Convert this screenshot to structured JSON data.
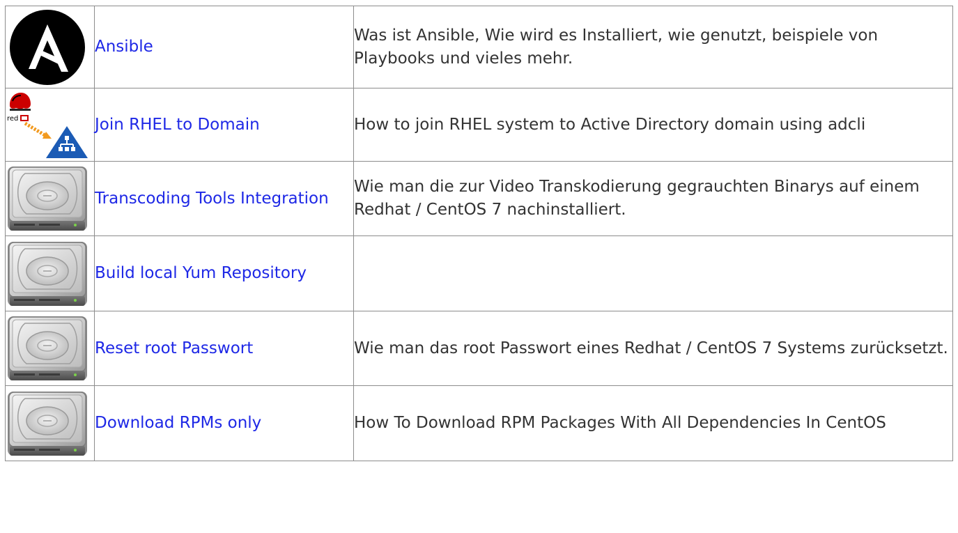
{
  "rows": [
    {
      "icon": "ansible-logo-icon",
      "link": "Ansible",
      "description": "Was ist Ansible, Wie wird es Installiert, wie genutzt, beispiele von Playbooks und vieles mehr."
    },
    {
      "icon": "redhat-join-domain-icon",
      "link": "Join RHEL to Domain",
      "description": "How to join RHEL system to Active Directory domain using adcli"
    },
    {
      "icon": "hard-drive-icon",
      "link": "Transcoding Tools Integration",
      "description": "Wie man die zur Video Transkodierung gegrauchten Binarys auf einem Redhat / CentOS 7 nachinstalliert."
    },
    {
      "icon": "hard-drive-icon",
      "link": "Build local Yum Repository",
      "description": ""
    },
    {
      "icon": "hard-drive-icon",
      "link": "Reset root Passwort",
      "description": "Wie man das root Passwort eines Redhat / CentOS 7 Systems zurücksetzt."
    },
    {
      "icon": "hard-drive-icon",
      "link": "Download RPMs only",
      "description": "How To Download RPM Packages With All Dependencies In CentOS"
    }
  ],
  "colors": {
    "link": "#1e28e6",
    "text": "#333333",
    "border": "#8c8c8c",
    "ansible_bg": "#000000",
    "redhat_red": "#cc0000",
    "ad_blue": "#1b5bb5",
    "arrow_orange": "#f29a1f"
  }
}
